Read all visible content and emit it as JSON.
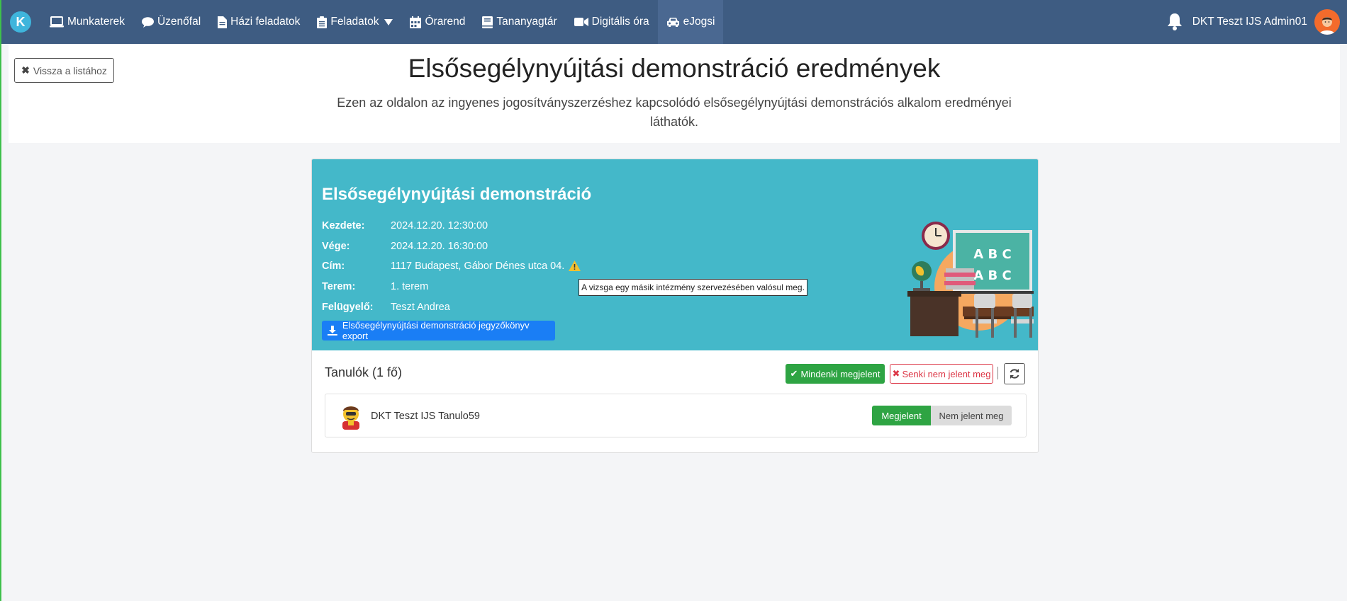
{
  "nav": {
    "logo_letter": "K",
    "items": [
      {
        "label": "Munkaterek"
      },
      {
        "label": "Üzenőfal"
      },
      {
        "label": "Házi feladatok"
      },
      {
        "label": "Feladatok"
      },
      {
        "label": "Órarend"
      },
      {
        "label": "Tananyagtár"
      },
      {
        "label": "Digitális óra"
      },
      {
        "label": "eJogsi"
      }
    ],
    "user_name": "DKT Teszt IJS Admin01"
  },
  "header": {
    "back_label": "Vissza a listához",
    "title": "Elsősegélynyújtási demonstráció eredmények",
    "description": "Ezen az oldalon az ingyenes jogosítványszerzéshez kapcsolódó elsősegélynyújtási demonstrációs alkalom eredményei láthatók."
  },
  "card": {
    "title": "Elsősegélynyújtási demonstráció",
    "rows": [
      {
        "label": "Kezdete:",
        "value": "2024.12.20. 12:30:00"
      },
      {
        "label": "Vége:",
        "value": "2024.12.20. 16:30:00"
      },
      {
        "label": "Cím:",
        "value": "1117 Budapest, Gábor Dénes utca 04."
      },
      {
        "label": "Terem:",
        "value": "1. terem"
      },
      {
        "label": "Felügyelő:",
        "value": "Teszt Andrea"
      }
    ],
    "tooltip": "A vizsga egy másik intézmény szervezésében valósul meg.",
    "export_label": "Elsősegélynyújtási demonstráció jegyzőkönyv export",
    "board_text": [
      "A B C",
      "A B C"
    ]
  },
  "students": {
    "title": "Tanulók (1 fő)",
    "all_label": "Mindenki megjelent",
    "none_label": "Senki nem jelent meg",
    "list": [
      {
        "name": "DKT Teszt IJS Tanulo59",
        "present_label": "Megjelent",
        "absent_label": "Nem jelent meg"
      }
    ]
  },
  "colors": {
    "navbar": "#3e5c82",
    "card_top": "#44b8c9",
    "success": "#2ea443",
    "danger": "#dc3545",
    "primary": "#1a7ef5"
  }
}
